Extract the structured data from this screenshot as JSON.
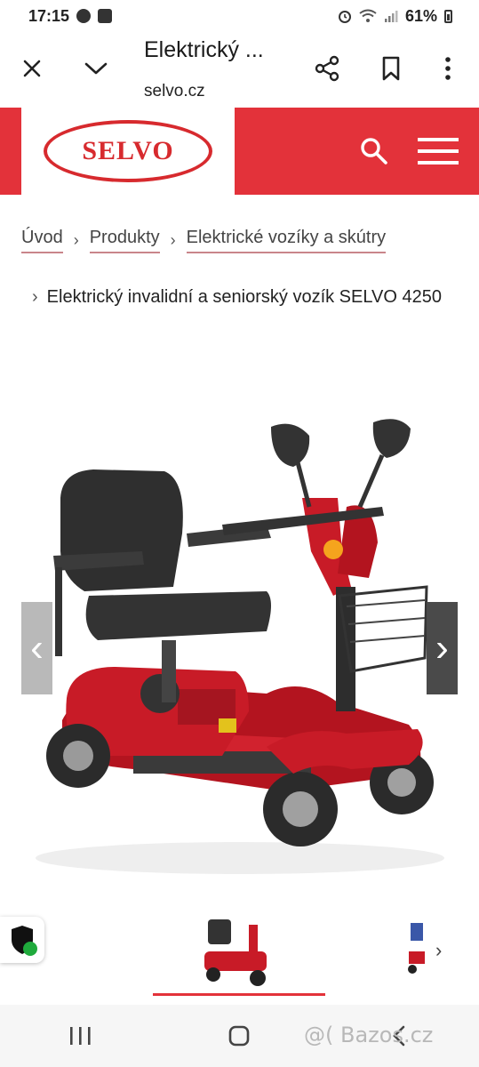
{
  "status_bar": {
    "time": "17:15",
    "battery": "61%"
  },
  "browser": {
    "title": "Elektrický ...",
    "url": "selvo.cz"
  },
  "site": {
    "logo_text": "SELVO",
    "accent": "#e3323a"
  },
  "breadcrumb": {
    "items": [
      "Úvod",
      "Produkty",
      "Elektrické vozíky a skútry"
    ],
    "current": "Elektrický invalidní a seniorský vozík SELVO 4250",
    "separator": "›"
  },
  "gallery": {
    "prev_icon": "‹",
    "next_icon": "›",
    "thumb_next_icon": "›"
  },
  "watermark": "@( Bazos.cz"
}
